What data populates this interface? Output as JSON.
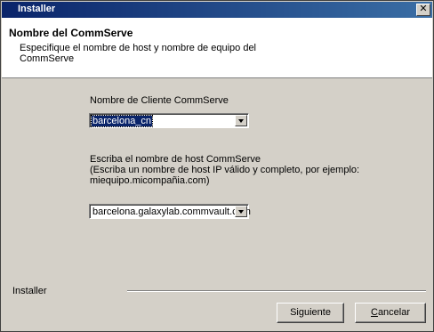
{
  "window": {
    "title": "Installer",
    "close_glyph": "✕"
  },
  "header": {
    "title": "Nombre del CommServe",
    "subtitle": "Especifique el nombre de host y nombre de equipo del CommServe"
  },
  "form": {
    "client_label": "Nombre de Cliente CommServe",
    "client_value": "barcelona_cn",
    "host_label_1": "Escriba el nombre de host CommServe",
    "host_label_2": "(Escriba un nombre de host IP válido y completo, por ejemplo:",
    "host_label_3": "miequipo.micompañia.com)",
    "host_value": "barcelona.galaxylab.commvault.com"
  },
  "footer": {
    "label": "Installer",
    "next_label": "Siguiente",
    "cancel_first": "C",
    "cancel_rest": "ancelar"
  }
}
